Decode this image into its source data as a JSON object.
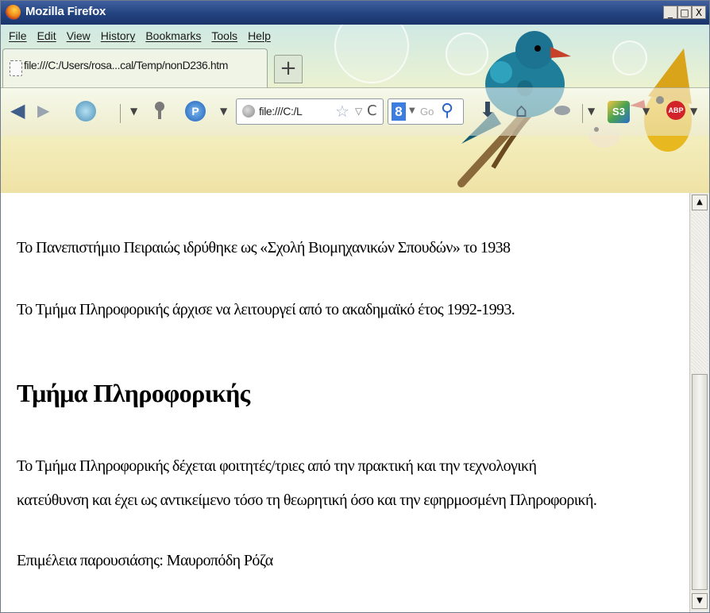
{
  "window": {
    "title": "Mozilla Firefox",
    "controls": [
      "_",
      "□",
      "X"
    ]
  },
  "menubar": {
    "items": [
      "File",
      "Edit",
      "View",
      "History",
      "Bookmarks",
      "Tools",
      "Help"
    ]
  },
  "tabs": [
    {
      "label": "file:///C:/Users/rosa...cal/Temp/nonD236.htm"
    }
  ],
  "new_tab_label": "+",
  "navbar": {
    "url_text": "file:///C:/L",
    "search_placeholder": "Go",
    "search_engine_label": "8",
    "icons": [
      "back-arrow-icon",
      "forward-arrow-icon",
      "history-icon",
      "addon-icon",
      "plugin-icon",
      "globe-icon",
      "star-icon",
      "reload-icon",
      "download-icon",
      "home-icon",
      "s3-icon",
      "adblock-icon"
    ]
  },
  "content": {
    "para1": "Το Πανεπιστήμιο Πειραιώς ιδρύθηκε ως «Σχολή Βιομηχανικών Σπουδών» το 1938",
    "para2": "Το Τμήμα Πληροφορικής άρχισε να λειτουργεί από το ακαδημαϊκό έτος 1992-1993.",
    "heading": "Τμήμα Πληροφορικής",
    "para3_line1": "Το Τμήμα Πληροφορικής δέχεται φοιτητές/τριες από την πρακτική και την τεχνολογική",
    "para3_line2": "κατεύθυνση και έχει ως αντικείμενο τόσο τη θεωρητική όσο και την εφηρμοσμένη Πληροφορική.",
    "footer": "Επιμέλεια παρουσιάσης: Μαυροπόδη Ρόζα"
  },
  "scrollbar": {
    "position_fraction": 0.5
  },
  "colors": {
    "titlebar": "#22427f",
    "accent_search": "#3d7de0"
  }
}
